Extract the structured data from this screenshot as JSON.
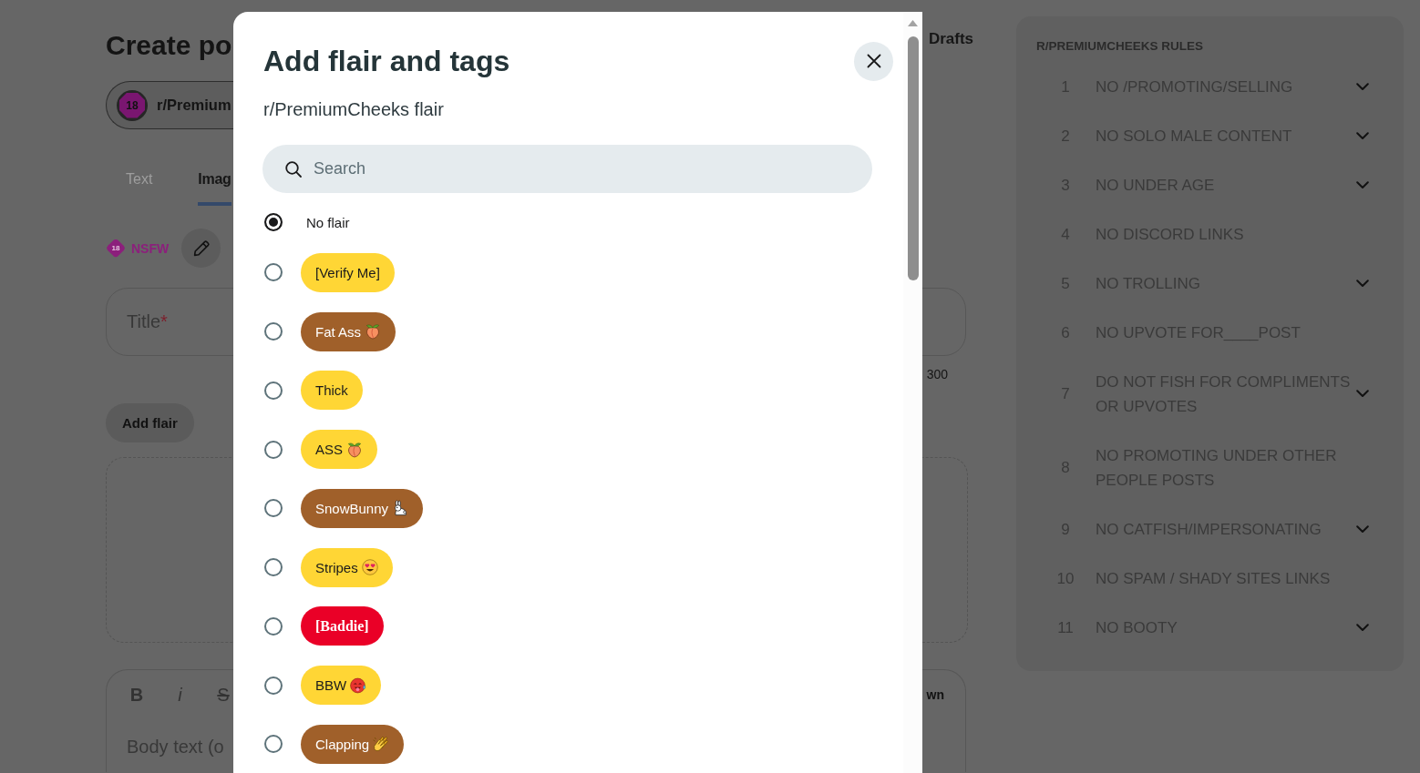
{
  "page": {
    "heading": "Create po",
    "drafts_link": "Drafts",
    "community": {
      "avatar_badge": "18",
      "name": "r/Premium"
    },
    "post_type_tabs": [
      {
        "label": "Text",
        "selected": false,
        "disabled": true
      },
      {
        "label": "Imag",
        "selected": true,
        "disabled": false
      }
    ],
    "nsfw_tag": {
      "badge": "18",
      "label": "NSFW"
    },
    "title_field": {
      "placeholder": "Title",
      "required_mark": "*",
      "counter": "300"
    },
    "add_flair_button": "Add flair",
    "body_editor": {
      "format_buttons": [
        {
          "label": "B",
          "kind": "bold"
        },
        {
          "label": "i",
          "kind": "italic"
        },
        {
          "label": "S",
          "kind": "strike"
        }
      ],
      "mode_button": "wn",
      "placeholder": "Body text (o"
    }
  },
  "rules": {
    "heading": "R/PREMIUMCHEEKS RULES",
    "items": [
      {
        "number": "1",
        "text": "NO /PROMOTING/SELLING",
        "expandable": true
      },
      {
        "number": "2",
        "text": "NO SOLO MALE CONTENT",
        "expandable": true
      },
      {
        "number": "3",
        "text": "NO UNDER AGE",
        "expandable": true
      },
      {
        "number": "4",
        "text": "NO DISCORD LINKS",
        "expandable": false
      },
      {
        "number": "5",
        "text": "NO TROLLING",
        "expandable": true
      },
      {
        "number": "6",
        "text": "NO UPVOTE FOR____POST",
        "expandable": false
      },
      {
        "number": "7",
        "text": "DO NOT FISH FOR COMPLIMENTS OR UPVOTES",
        "expandable": true
      },
      {
        "number": "8",
        "text": "NO PROMOTING UNDER OTHER PEOPLE POSTS",
        "expandable": false
      },
      {
        "number": "9",
        "text": "NO CATFISH/IMPERSONATING",
        "expandable": true
      },
      {
        "number": "10",
        "text": "NO SPAM / SHADY SITES LINKS",
        "expandable": false
      },
      {
        "number": "11",
        "text": "NO BOOTY",
        "expandable": true
      }
    ]
  },
  "dialog": {
    "title": "Add flair and tags",
    "subtitle": "r/PremiumCheeks flair",
    "search": {
      "placeholder": "Search"
    },
    "options": [
      {
        "kind": "plain",
        "label": "No flair",
        "selected": true
      },
      {
        "kind": "pill",
        "label": "[Verify Me]",
        "color": "#ffd635",
        "selected": false
      },
      {
        "kind": "pill",
        "label": "Fat Ass",
        "color": "#a0602a",
        "selected": false
      },
      {
        "kind": "pill",
        "label": "Thick",
        "color": "#ffd635",
        "selected": false
      },
      {
        "kind": "pill",
        "label": "ASS",
        "color": "#ffd635",
        "selected": false
      },
      {
        "kind": "pill",
        "label": "SnowBunny",
        "color": "#a0602a",
        "selected": false
      },
      {
        "kind": "pill",
        "label": "Stripes",
        "color": "#ffd635",
        "selected": false
      },
      {
        "kind": "fancy",
        "label": "[Baddie]",
        "color": "#ea0027",
        "selected": false
      },
      {
        "kind": "pill",
        "label": "BBW",
        "color": "#ffd635",
        "selected": false
      },
      {
        "kind": "pill",
        "label": "Clapping",
        "color": "#a0602a",
        "selected": false
      }
    ]
  }
}
